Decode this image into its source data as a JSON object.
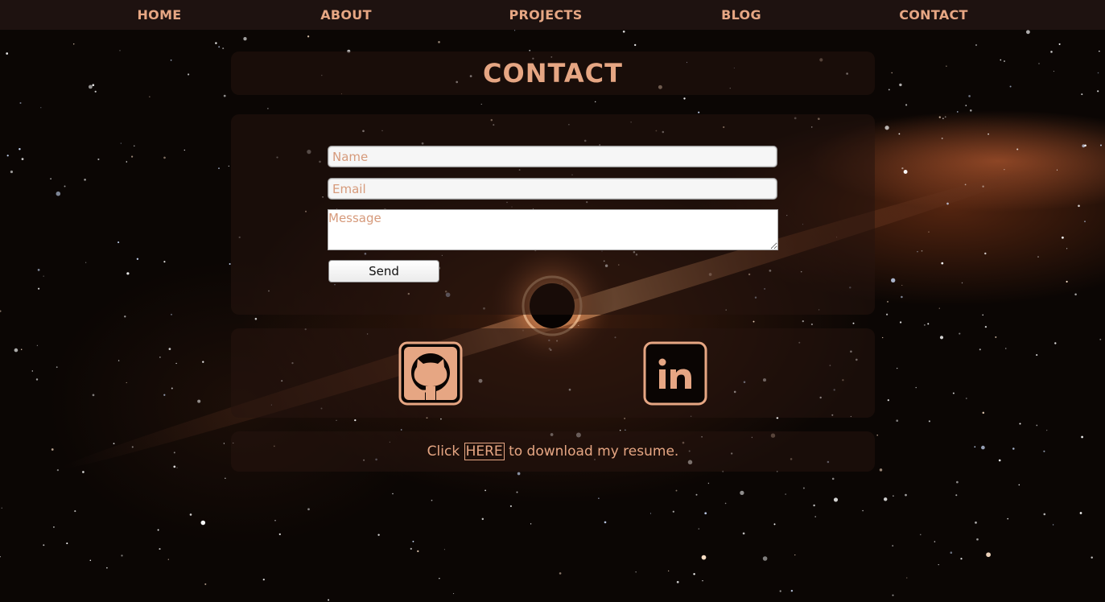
{
  "nav": {
    "items": [
      {
        "label": "HOME"
      },
      {
        "label": "ABOUT"
      },
      {
        "label": "PROJECTS"
      },
      {
        "label": "BLOG"
      },
      {
        "label": "CONTACT"
      }
    ]
  },
  "page": {
    "title": "CONTACT"
  },
  "form": {
    "name_placeholder": "Name",
    "name_value": "",
    "email_placeholder": "Email",
    "email_value": "",
    "message_placeholder": "Message",
    "message_value": "",
    "send_label": "Send"
  },
  "social": [
    {
      "icon": "github-icon"
    },
    {
      "icon": "linkedin-icon"
    }
  ],
  "resume": {
    "prefix": "Click",
    "link_label": "HERE",
    "suffix": "to download my resume."
  },
  "colors": {
    "accent": "#e6a683",
    "nav_bg": "#1e1210",
    "panel_bg": "#26140e",
    "space_bg": "#0b0604",
    "galaxy_glow": "#dc6e3c"
  }
}
